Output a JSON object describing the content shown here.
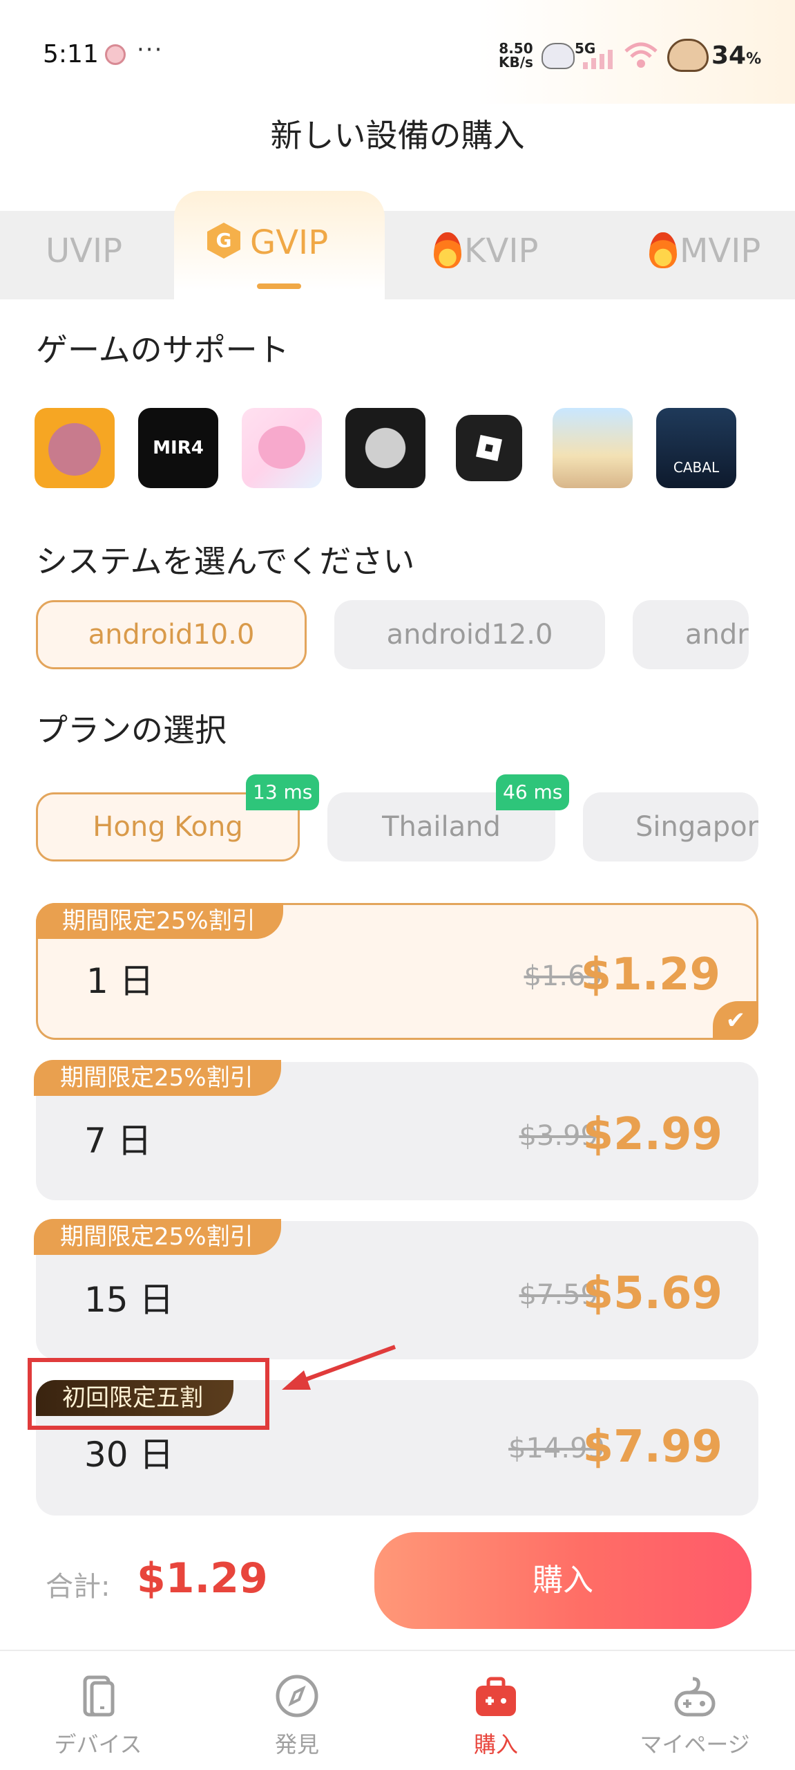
{
  "status": {
    "time": "5:11",
    "dots": "···",
    "net_speed_top": "8.50",
    "net_speed_bottom": "KB/s",
    "signal": "5G",
    "battery": "34",
    "battery_unit": "%"
  },
  "header": {
    "title": "新しい設備の購入"
  },
  "tabs": [
    {
      "label": "UVIP"
    },
    {
      "label": "GVIP",
      "icon_letter": "G",
      "active": true
    },
    {
      "label": "KVIP",
      "icon": "fire-icon"
    },
    {
      "label": "MVIP",
      "icon": "fire-icon"
    }
  ],
  "games_section": {
    "title": "ゲームのサポート",
    "games": [
      {
        "icon": "dragon-game-icon"
      },
      {
        "icon": "mir4-game-icon",
        "text": "MIR4"
      },
      {
        "icon": "pink-creature-game-icon"
      },
      {
        "icon": "crow-moon-game-icon"
      },
      {
        "icon": "roblox-game-icon"
      },
      {
        "icon": "ragnarok-game-icon"
      },
      {
        "icon": "cabal-game-icon",
        "text": "CABAL"
      }
    ]
  },
  "system_section": {
    "title": "システムを選んでください",
    "options": [
      "android10.0",
      "android12.0",
      "andr"
    ]
  },
  "plan_section": {
    "title": "プランの選択",
    "regions": [
      {
        "label": "Hong Kong",
        "latency": "13 ms"
      },
      {
        "label": "Thailand",
        "latency": "46 ms"
      },
      {
        "label": "Singapor"
      }
    ]
  },
  "plans": [
    {
      "badge": "期間限定25%割引",
      "duration": "1 日",
      "old_price": "$1.69",
      "price": "$1.29",
      "selected": true
    },
    {
      "badge": "期間限定25%割引",
      "duration": "7 日",
      "old_price": "$3.99",
      "price": "$2.99"
    },
    {
      "badge": "期間限定25%割引",
      "duration": "15 日",
      "old_price": "$7.59",
      "price": "$5.69"
    },
    {
      "badge": "初回限定五割",
      "duration": "30 日",
      "old_price": "$14.99",
      "price": "$7.99"
    }
  ],
  "footer": {
    "total_label": "合計:",
    "total_value": "$1.29",
    "buy_label": "購入"
  },
  "bottom_nav": [
    {
      "label": "デバイス",
      "icon": "devices-icon"
    },
    {
      "label": "発見",
      "icon": "compass-icon"
    },
    {
      "label": "購入",
      "icon": "shop-bag-icon",
      "active": true
    },
    {
      "label": "マイページ",
      "icon": "gamepad-icon"
    }
  ],
  "colors": {
    "accent": "#e9a04f",
    "price_red": "#e8453c",
    "latency_green": "#2ec57a",
    "annotation_red": "#e03b3b"
  }
}
